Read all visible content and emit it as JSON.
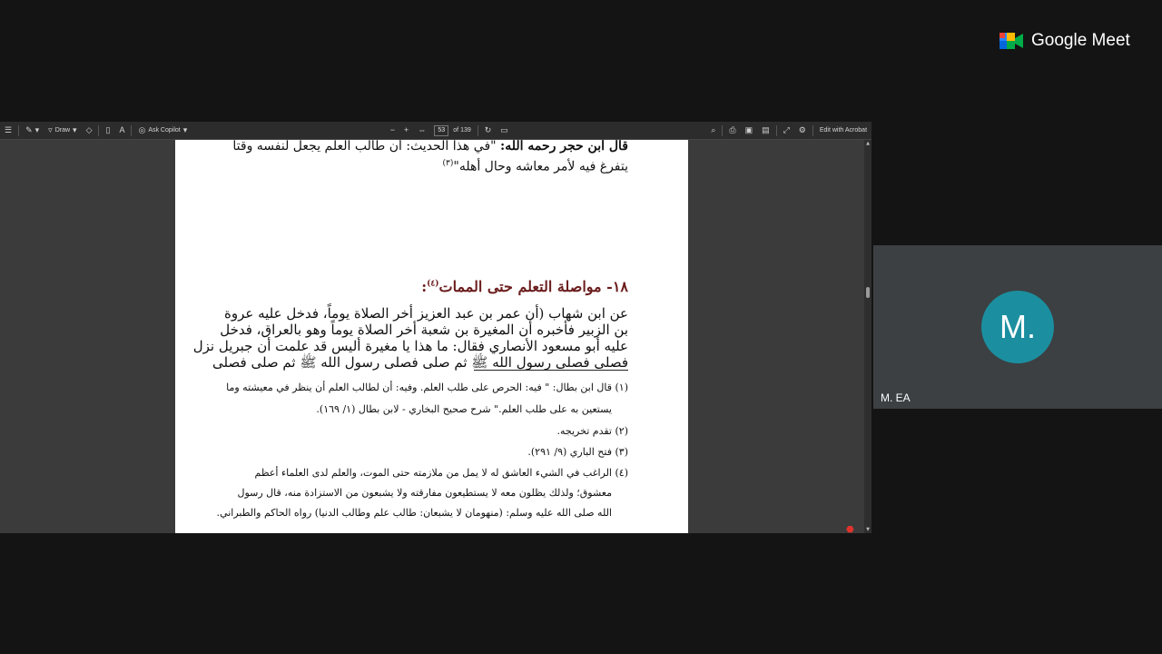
{
  "toolbar": {
    "draw_label": "Draw",
    "copilot_label": "Ask Copilot",
    "page_number": "53",
    "page_total": "of 139",
    "edit_label": "Edit with Acrobat"
  },
  "document": {
    "top_line_1_bold": "قال ابن حجر رحمه الله:",
    "top_line_1_rest": " \"في هذا الحديث: أن طالب العلم يجعل لنفسه وقتا",
    "top_line_2": "يتفرغ فيه لأمر معاشه وحال أهله\"",
    "top_line_2_ref": "(٣)",
    "heading": "١٨- مواصلة التعلم حتى الممات",
    "heading_ref": "(٤)",
    "heading_colon": ":",
    "body_lines": [
      "عن ابن شهاب (أن عمر بن عبد العزيز أخر الصلاة يوماً، فدخل عليه عروة",
      "بن الزبير فأخبره أن المغيرة بن شعبة أخر الصلاة يوماً وهو بالعراق، فدخل",
      "عليه أبو مسعود الأنصاري فقال: ما هذا يا مغيرة أليس قد علمت أن جبريل نزل",
      "فصلى فصلى رسول الله ﷺ ثم صلى فصلى رسول الله ﷺ ثم صلى فصلى"
    ],
    "footnotes": [
      "(١) قال ابن بطال: \" فيه: الحرص على طلب العلم. وفيه: أن لطالب العلم أن ينظر في معيشته وما",
      "يستعين به على طلب العلم.\" شرح صحيح البخاري - لابن بطال (١/ ١٦٩).",
      "(٢) تقدم تخريجه.",
      "(٣) فتح الباري (٩/ ٢٩١).",
      "(٤) الراغب في الشيء العاشق له لا يمل من ملازمته حتى الموت، والعلم لدى العلماء أعظم",
      "معشوق؛ ولذلك يظلون معه لا يستطيعون مفارقته ولا يشبعون من الاستزادة منه، قال رسول",
      "الله صلى الله عليه وسلم: (منهومان لا يشبعان: طالب علم وطالب الدنيا) رواه الحاكم والطبراني."
    ]
  },
  "meet": {
    "brand": "Google Meet",
    "participant_initial": "M.",
    "participant_name": "M. EA",
    "avatar_color": "#1b8fa0"
  }
}
